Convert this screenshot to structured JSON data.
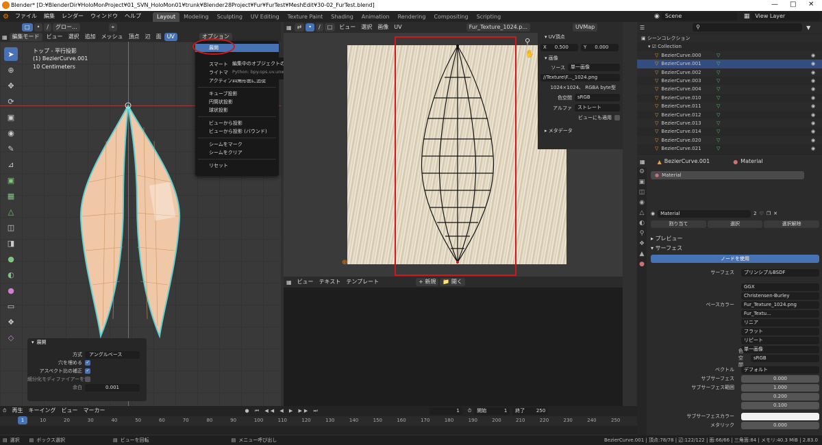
{
  "window": {
    "title": "Blender* [D:¥BlenderDir¥HoloMonProject¥01_SVN_HoloMon01¥trunk¥Blender28Project¥Fur¥FurTest¥MeshEdit¥30-02_FurTest.blend]"
  },
  "menubar": {
    "items": [
      "ファイル",
      "編集",
      "レンダー",
      "ウィンドウ",
      "ヘルプ"
    ],
    "workspaces": [
      "Layout",
      "Modeling",
      "Sculpting",
      "UV Editing",
      "Texture Paint",
      "Shading",
      "Animation",
      "Rendering",
      "Compositing",
      "Scripting"
    ],
    "active_workspace": "Layout",
    "scene": "Scene",
    "view_layer": "View Layer"
  },
  "viewport": {
    "mode": "編集モード",
    "menus": [
      "ビュー",
      "選択",
      "追加",
      "メッシュ",
      "頂点",
      "辺",
      "面",
      "UV"
    ],
    "transform": "グロー...",
    "options": "オプション",
    "view_name": "トップ - 平行投影",
    "object_name": "(1) BezierCurve.001",
    "scale": "10 Centimeters"
  },
  "uv_menu": {
    "items": [
      "展開",
      "スマートUV投影",
      "ライトマップパック",
      "アクティブ四角形面に追従",
      "キューブ投影",
      "円筒状投影",
      "球状投影",
      "ビューから投影",
      "ビューから投影 (バウンド)",
      "シームをマーク",
      "シームをクリア",
      "リセット"
    ],
    "visible": [
      "展開",
      "スマート",
      "ライトマ",
      "アクティブ四角形面に追従",
      "キューブ投影",
      "円筒状投影",
      "球状投影",
      "ビューから投影",
      "ビューから投影 (バウンド)",
      "シームをマーク",
      "シームをクリア",
      "リセット"
    ]
  },
  "tooltip": {
    "text": "編集中のオブジェクトのメッシュを展開します。",
    "python": "Python: bpy.ops.uv.unwrap()"
  },
  "op_panel": {
    "title": "展開",
    "method_label": "方式",
    "method_value": "アングルベース",
    "fill_holes": "穴を埋める",
    "correct_aspect": "アスペクト比の補正",
    "use_subsurf": "細分化モディファイアーを使用",
    "margin_label": "余白",
    "margin_value": "0.001"
  },
  "uv_editor": {
    "menus": [
      "ビュー",
      "選択",
      "画像",
      "UV"
    ],
    "image_name": "Fur_Texture_1024.p...",
    "uv_map": "UVMap"
  },
  "n_panel": {
    "uv_vertex": "UV頂点",
    "x_label": "X",
    "x_value": "0.500",
    "y_label": "Y",
    "y_value": "0.000",
    "image_section": "画像",
    "source_label": "ソース",
    "source_value": "単一画像",
    "filepath": "//Texture\\F..._1024.png",
    "image_info": "1024×1024、 RGBA byte型",
    "colorspace_label": "色空間",
    "colorspace_value": "sRGB",
    "alpha_label": "アルファ",
    "alpha_value": "ストレート",
    "view_as_render": "ビューにも適用",
    "metadata": "メタデータ"
  },
  "text_editor": {
    "menus": [
      "ビュー",
      "テキスト",
      "テンプレート"
    ],
    "new": "新規",
    "open": "開く"
  },
  "outliner": {
    "search_placeholder": "",
    "root": "シーンコレクション",
    "collection": "Collection",
    "items": [
      "BezierCurve.000",
      "BezierCurve.001",
      "BezierCurve.002",
      "BezierCurve.003",
      "BezierCurve.004",
      "BezierCurve.010",
      "BezierCurve.011",
      "BezierCurve.012",
      "BezierCurve.013",
      "BezierCurve.014",
      "BezierCurve.020",
      "BezierCurve.021"
    ],
    "selected": "BezierCurve.001"
  },
  "properties": {
    "object": "BezierCurve.001",
    "material_tab": "Material",
    "slot": "Material",
    "material_name": "Material",
    "users": "2",
    "assign": "割り当て",
    "select": "選択",
    "deselect": "選択解除",
    "preview": "プレビュー",
    "surface": "サーフェス",
    "use_nodes": "ノードを使用",
    "surface_label": "サーフェス",
    "surface_value": "プリンシプルBSDF",
    "distribution": "GGX",
    "subsurface_method": "Christensen-Burley",
    "base_color_label": "ベースカラー",
    "base_color_value": "Fur_Texture_1024.png",
    "image_name": "Fur_Textu...",
    "interpolation": "リニア",
    "projection": "フラット",
    "extension": "リピート",
    "source": "単一画像",
    "colorspace_label": "色空間",
    "colorspace_value": "sRGB",
    "vector_label": "ベクトル",
    "vector_value": "デフォルト",
    "subsurface_label": "サブサーフェス",
    "subsurface_value": "0.000",
    "subsurface_radius_label": "サブサーフェス範囲",
    "radius_values": [
      "1.000",
      "0.200",
      "0.100"
    ],
    "subsurface_color_label": "サブサーフェスカラー",
    "metallic_label": "メタリック",
    "metallic_value": "0.000"
  },
  "timeline": {
    "playback": "再生",
    "keying": "キーイング",
    "view": "ビュー",
    "marker": "マーカー",
    "current_frame": "1",
    "start_label": "開始",
    "start": "1",
    "end_label": "終了",
    "end": "250",
    "ticks": [
      "1",
      "10",
      "20",
      "30",
      "40",
      "50",
      "60",
      "70",
      "80",
      "90",
      "100",
      "110",
      "120",
      "130",
      "140",
      "150",
      "160",
      "170",
      "180",
      "190",
      "200",
      "210",
      "220",
      "230",
      "240",
      "250"
    ]
  },
  "statusbar": {
    "select": "選択",
    "box_select": "ボックス選択",
    "rotate_view": "ビューを回転",
    "call_menu": "メニュー呼び出し",
    "stats": "BezierCurve.001 | 頂点:78/78 | 辺:122/122 | 面:66/66 | 三角面:84 | メモリ:40.3 MiB | 2.83.0"
  },
  "colors": {
    "accent": "#4772b3",
    "annotation_red": "#d01818",
    "mesh_fill": "#f0c8a8"
  }
}
